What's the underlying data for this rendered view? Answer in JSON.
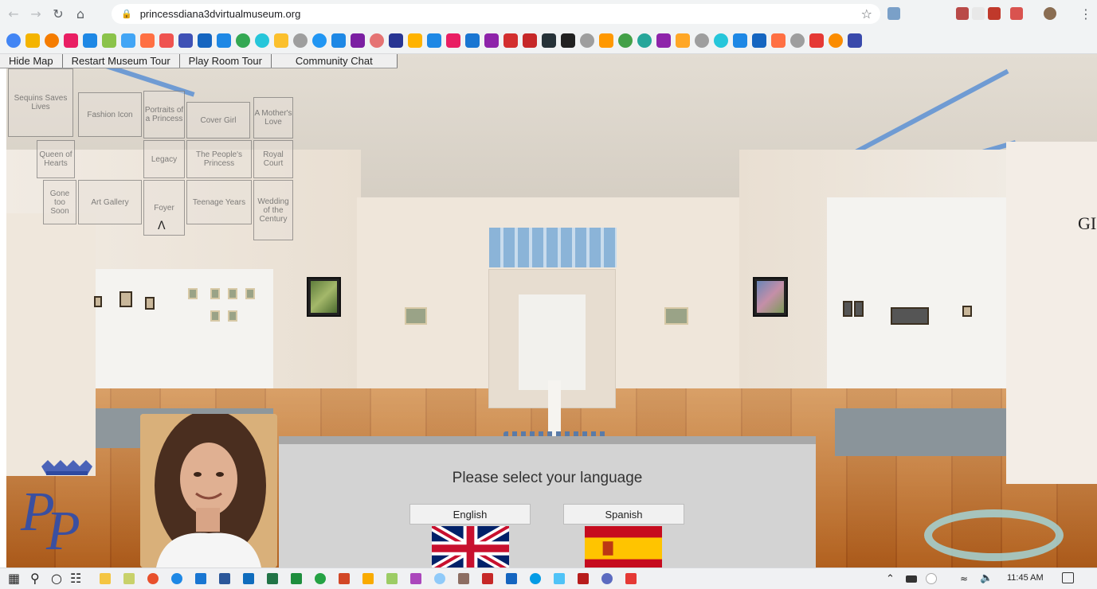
{
  "browser": {
    "url": "princessdiana3dvirtualmuseum.org"
  },
  "menu": {
    "items": [
      "Hide Map",
      "Restart Museum Tour",
      "Play Room Tour",
      "Community Chat"
    ]
  },
  "map": {
    "rooms": {
      "sequins": "Sequins Saves Lives",
      "fashion": "Fashion Icon",
      "portraits": "Portraits of a Princess",
      "cover_girl": "Cover Girl",
      "mothers_love": "A Mother's Love",
      "queen_of_hearts": "Queen of Hearts",
      "legacy": "Legacy",
      "peoples_princess": "The People's Princess",
      "royal_court": "Royal Court",
      "gone_too_soon": "Gone too Soon",
      "art_gallery": "Art Gallery",
      "foyer": "Foyer",
      "teenage_years": "Teenage Years",
      "wedding": "Wedding of the Century"
    }
  },
  "scene": {
    "wall_text": "GI"
  },
  "dialog": {
    "title": "Please select your language",
    "english_label": "English",
    "spanish_label": "Spanish"
  },
  "taskbar": {
    "time": "11:45 AM"
  },
  "colors": {
    "dialog_bg": "#d3d3d3",
    "floor": "#d9a55f",
    "ring": "#a3d4d6",
    "logo": "#3a4fa0"
  }
}
